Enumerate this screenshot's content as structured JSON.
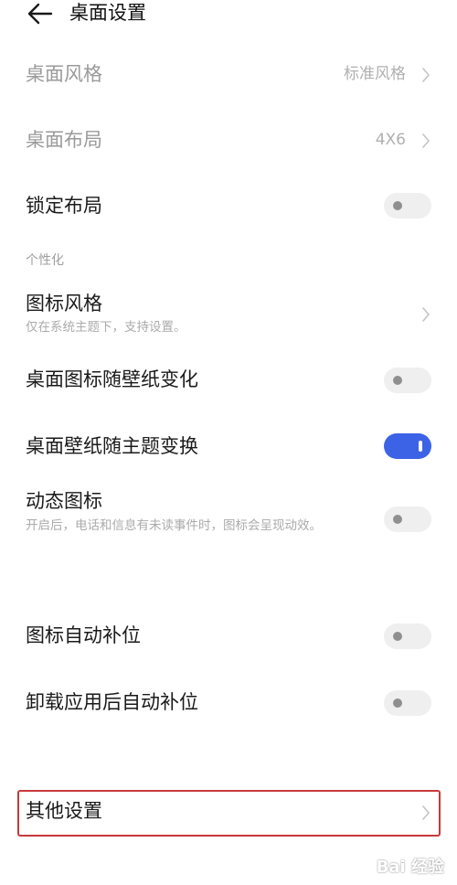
{
  "header": {
    "title": "桌面设置",
    "back_icon": "arrow-left-icon"
  },
  "rows": {
    "desktop_style": {
      "label": "桌面风格",
      "value": "标准风格"
    },
    "desktop_layout": {
      "label": "桌面布局",
      "value": "4X6"
    },
    "lock_layout": {
      "label": "锁定布局",
      "enabled": false
    }
  },
  "sections": {
    "personalize": "个性化"
  },
  "personal": {
    "icon_style": {
      "label": "图标风格",
      "sub": "仅在系统主题下，支持设置。"
    },
    "icon_follow_wallpaper": {
      "label": "桌面图标随壁纸变化",
      "enabled": false
    },
    "wallpaper_follow_theme": {
      "label": "桌面壁纸随主题变换",
      "enabled": true
    },
    "dynamic_icon": {
      "label": "动态图标",
      "sub": "开启后，电话和信息有未读事件时，图标会呈现动效。",
      "enabled": false
    }
  },
  "more": {
    "auto_fill": {
      "label": "图标自动补位",
      "enabled": false
    },
    "auto_fill_uninstall": {
      "label": "卸载应用后自动补位",
      "enabled": false
    },
    "other": {
      "label": "其他设置"
    }
  },
  "watermark": {
    "text": "Bai 经验"
  },
  "colors": {
    "accent": "#3c63e6",
    "highlight_box": "#c8383a"
  }
}
